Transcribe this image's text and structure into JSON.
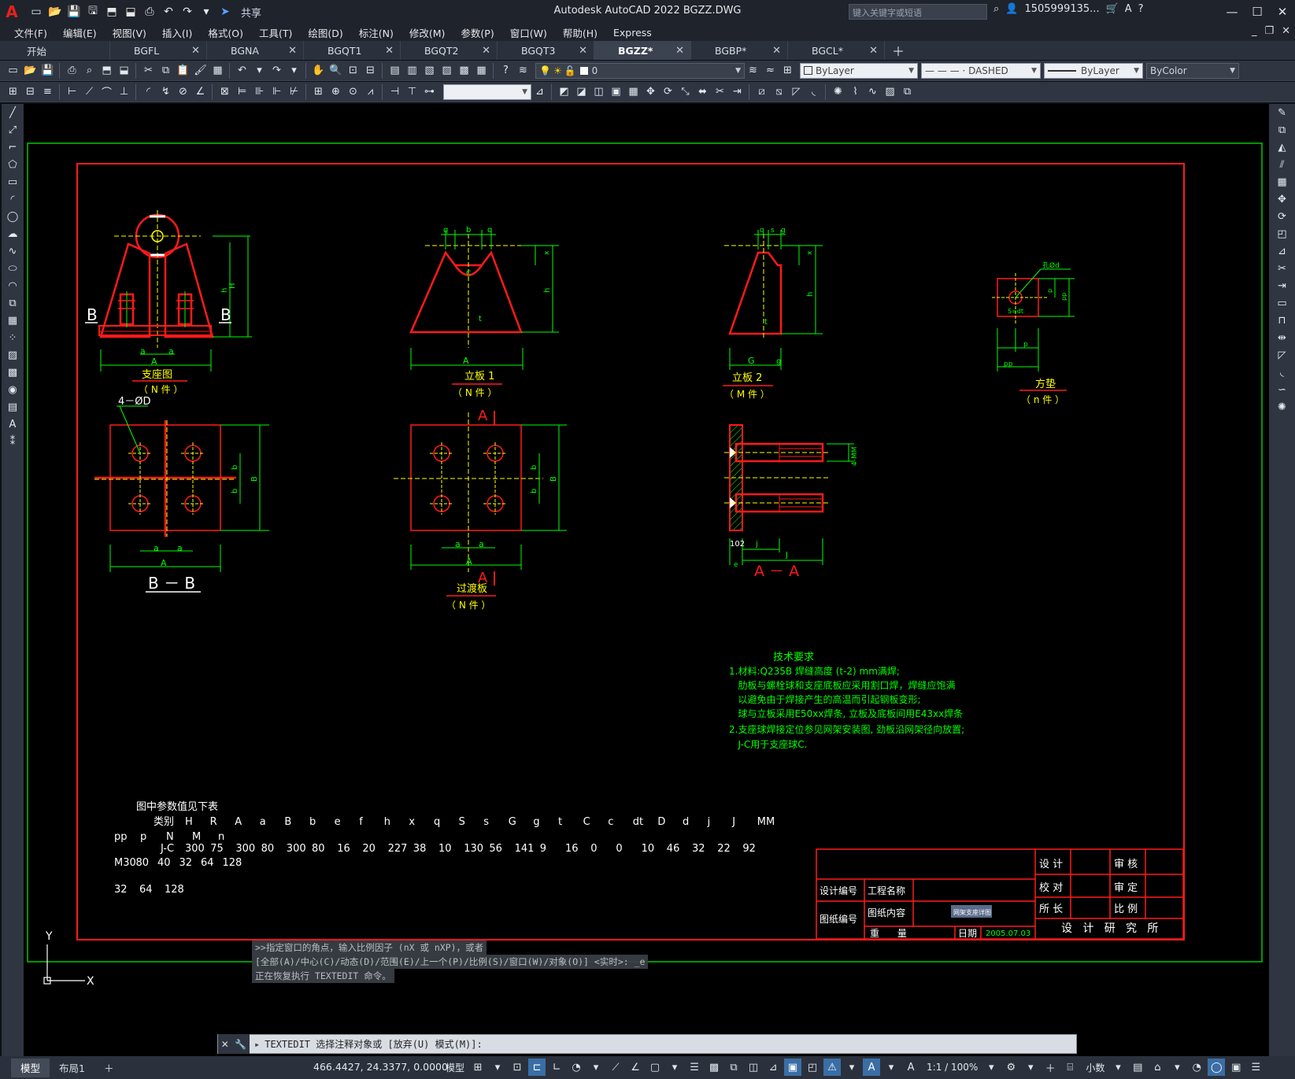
{
  "titlebar": {
    "logo": "A",
    "share": "共享",
    "app_title": "Autodesk AutoCAD 2022    BGZZ.DWG",
    "search_placeholder": "键入关键字或短语",
    "user": "1505999135...",
    "help": "?"
  },
  "menu": [
    "文件(F)",
    "编辑(E)",
    "视图(V)",
    "插入(I)",
    "格式(O)",
    "工具(T)",
    "绘图(D)",
    "标注(N)",
    "修改(M)",
    "参数(P)",
    "窗口(W)",
    "帮助(H)",
    "Express"
  ],
  "tabs": [
    {
      "label": "开始",
      "closable": false,
      "active": false
    },
    {
      "label": "BGFL",
      "closable": true,
      "active": false
    },
    {
      "label": "BGNA",
      "closable": true,
      "active": false
    },
    {
      "label": "BGQT1",
      "closable": true,
      "active": false
    },
    {
      "label": "BGQT2",
      "closable": true,
      "active": false
    },
    {
      "label": "BGQT3",
      "closable": true,
      "active": false
    },
    {
      "label": "BGZZ*",
      "closable": true,
      "active": true
    },
    {
      "label": "BGBP*",
      "closable": true,
      "active": false
    },
    {
      "label": "BGCL*",
      "closable": true,
      "active": false
    }
  ],
  "properties": {
    "layer": "0",
    "color": "ByLayer",
    "linetype": "— — — · DASHED",
    "lineweight": "ByLayer",
    "plotstyle": "ByColor"
  },
  "drawing": {
    "views": {
      "support": {
        "title": "支座图",
        "count": "（ N 件 ）"
      },
      "plate1": {
        "title": "立板 1",
        "count": "（ N 件 ）"
      },
      "plate2": {
        "title": "立板 2",
        "count": "（ M 件 ）"
      },
      "washer": {
        "title": "方垫",
        "count": "（ n 件 ）"
      },
      "transition": {
        "title": "过渡板",
        "count": "（ N 件 ）"
      },
      "section_bb": "B － B",
      "section_aa": "A － A",
      "holes_label": "4－ØD"
    },
    "tech": {
      "title": "技术要求",
      "lines": [
        "1.材料:Q235B 焊缝高度 (t-2) mm满焊;",
        "   肋板与螺栓球和支座底板应采用割口焊，焊缝应饱满",
        "   以避免由于焊接产生的高温而引起钢板变形;",
        "   球与立板采用E50xx焊条, 立板及底板间用E43xx焊条",
        "2.支座球焊接定位参见网架安装图, 劲板沿网架径向放置;",
        "   J-C用于支座球C."
      ]
    },
    "params": {
      "title": "图中参数值见下表",
      "header_label": "类别",
      "headers": [
        "H",
        "R",
        "A",
        "a",
        "B",
        "b",
        "e",
        "f",
        "h",
        "x",
        "q",
        "S",
        "s",
        "G",
        "g",
        "t",
        "C",
        "c",
        "dt",
        "D",
        "d",
        "j",
        "J",
        "MM"
      ],
      "headers2": [
        "pp",
        "p",
        "N",
        "M",
        "n"
      ],
      "row_label": "J-C",
      "row": [
        "300",
        "75",
        "300",
        "80",
        "300",
        "80",
        "16",
        "20",
        "227",
        "38",
        "10",
        "130",
        "56",
        "141",
        "9",
        "16",
        "0",
        "0",
        "10",
        "46",
        "32",
        "22",
        "92"
      ],
      "row2": [
        "M30",
        "80",
        "40",
        "32",
        "64",
        "128"
      ],
      "row3": [
        "32",
        "64",
        "128"
      ]
    },
    "titleblock": {
      "design": "设 计",
      "review": "审 核",
      "check": "校 对",
      "approve": "审 定",
      "director": "所 长",
      "scale": "比 例",
      "design_no": "设计编号",
      "project": "工程名称",
      "drawing_no": "图纸编号",
      "content": "图纸内容",
      "content_value": "网架支座详图",
      "weight": "重      量",
      "date_label": "日期",
      "date": "2005.07.03",
      "institute": "设   计   研   究   所"
    }
  },
  "command": {
    "history": [
      ">>指定窗口的角点，输入比例因子 (nX 或 nXP)，或者",
      "[全部(A)/中心(C)/动态(D)/范围(E)/上一个(P)/比例(S)/窗口(W)/对象(O)] <实时>: _e",
      "正在恢复执行 TEXTEDIT 命令。"
    ],
    "prompt": "TEXTEDIT 选择注释对象或 [放弃(U) 模式(M)]:"
  },
  "status": {
    "layouts": [
      "模型",
      "布局1"
    ],
    "coords": "466.4427, 24.3377, 0.0000",
    "model": "模型",
    "scale": "1:1 / 100%",
    "units": "小数"
  },
  "colors": {
    "red": "#ff1a1a",
    "green": "#00ff00",
    "yellow": "#ffff00",
    "white": "#ffffff",
    "bg": "#000000"
  }
}
